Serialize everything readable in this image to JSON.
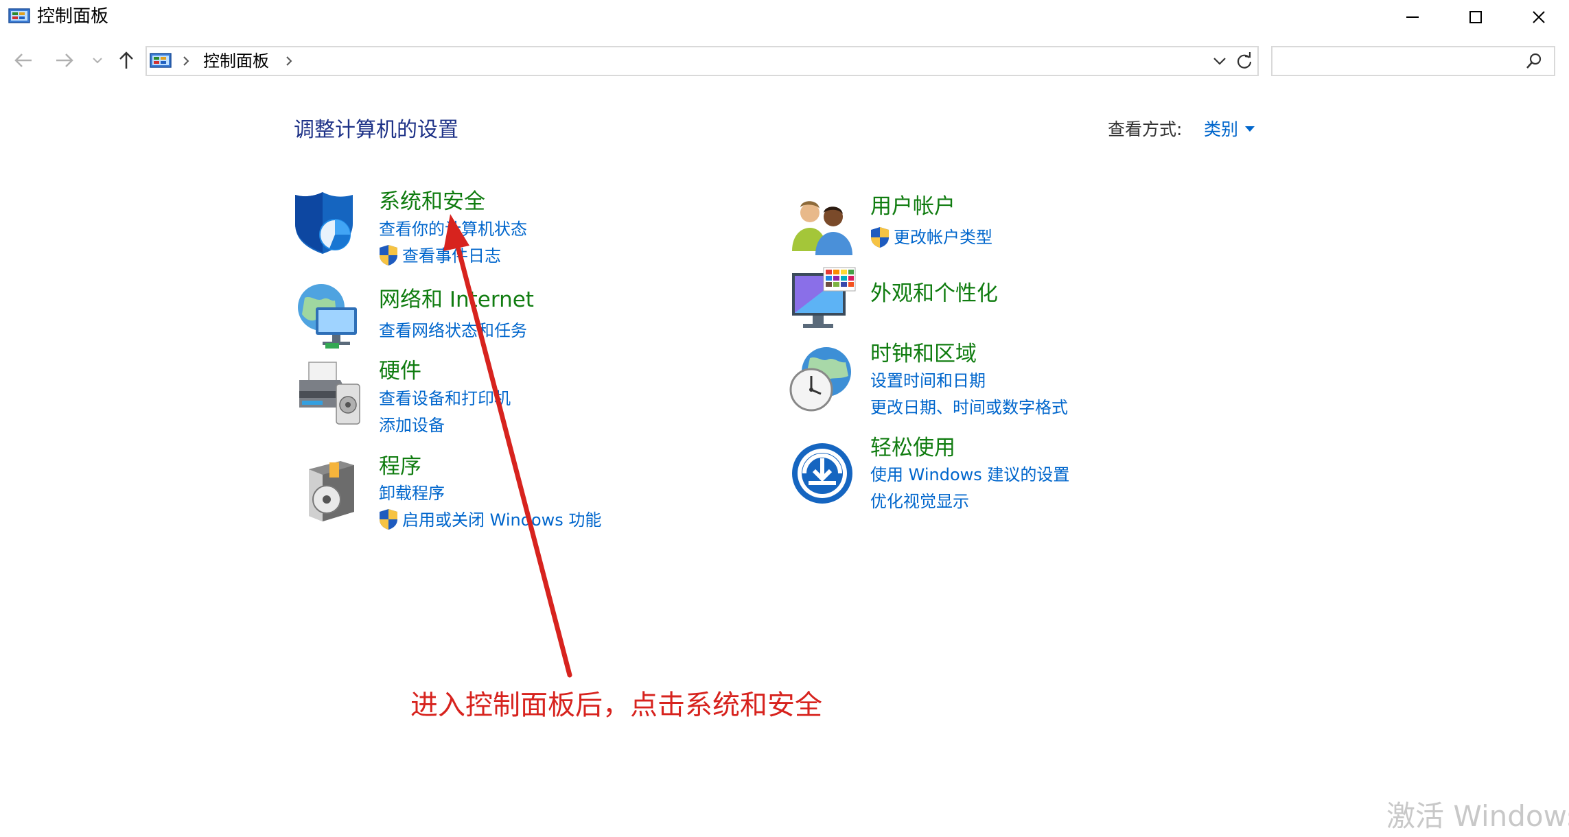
{
  "window": {
    "title": "控制面板",
    "minimize_glyph": "—",
    "maximize_glyph": "☐",
    "close_glyph": "✕"
  },
  "nav": {
    "back_icon": "arrow-left-icon",
    "forward_icon": "arrow-right-icon",
    "recent_icon": "chevron-down-icon",
    "up_icon": "arrow-up-icon"
  },
  "address": {
    "breadcrumb_label": "控制面板",
    "dropdown_icon": "chevron-down-icon",
    "refresh_icon": "refresh-icon"
  },
  "search": {
    "placeholder": "",
    "icon": "search-icon"
  },
  "content": {
    "title": "调整计算机的设置",
    "view_by_label": "查看方式:",
    "view_by_value": "类别"
  },
  "categories": {
    "system_security": {
      "title": "系统和安全",
      "links": [
        "查看你的计算机状态",
        "查看事件日志"
      ]
    },
    "network": {
      "title": "网络和 Internet",
      "links": [
        "查看网络状态和任务"
      ]
    },
    "hardware": {
      "title": "硬件",
      "links": [
        "查看设备和打印机",
        "添加设备"
      ]
    },
    "programs": {
      "title": "程序",
      "links": [
        "卸载程序",
        "启用或关闭 Windows 功能"
      ]
    },
    "user_accounts": {
      "title": "用户帐户",
      "links": [
        "更改帐户类型"
      ]
    },
    "appearance": {
      "title": "外观和个性化"
    },
    "clock_region": {
      "title": "时钟和区域",
      "links": [
        "设置时间和日期",
        "更改日期、时间或数字格式"
      ]
    },
    "ease_of_access": {
      "title": "轻松使用",
      "links": [
        "使用 Windows 建议的设置",
        "优化视觉显示"
      ]
    }
  },
  "annotation": {
    "text": "进入控制面板后，点击系统和安全",
    "color": "#d7231e"
  },
  "watermark": {
    "text": "激活 Windows"
  },
  "colors": {
    "category_title": "#107c10",
    "link": "#0066cc",
    "heading": "#1e3287"
  }
}
